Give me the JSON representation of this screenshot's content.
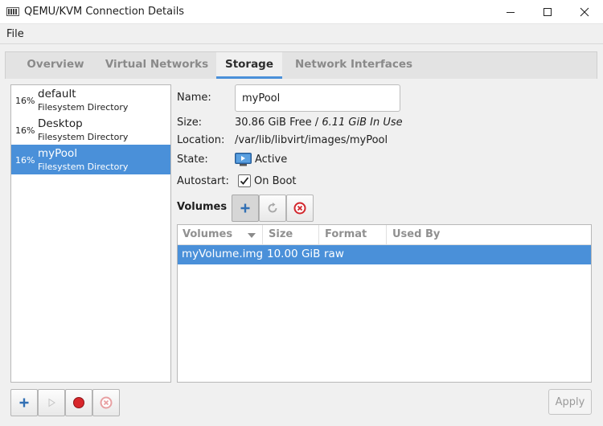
{
  "window": {
    "title": "QEMU/KVM Connection Details",
    "controls": {
      "minimize": "minimize-icon",
      "maximize": "maximize-icon",
      "close": "close-icon"
    }
  },
  "menubar": {
    "file": "File"
  },
  "tabs": [
    {
      "label": "Overview",
      "active": false
    },
    {
      "label": "Virtual Networks",
      "active": false
    },
    {
      "label": "Storage",
      "active": true
    },
    {
      "label": "Network Interfaces",
      "active": false
    }
  ],
  "pools": [
    {
      "percent": "16%",
      "name": "default",
      "type": "Filesystem Directory",
      "selected": false
    },
    {
      "percent": "16%",
      "name": "Desktop",
      "type": "Filesystem Directory",
      "selected": false
    },
    {
      "percent": "16%",
      "name": "myPool",
      "type": "Filesystem Directory",
      "selected": true
    }
  ],
  "details": {
    "name_label": "Name:",
    "name_value": "myPool",
    "size_label": "Size:",
    "size_free": "30.86 GiB Free / ",
    "size_inuse": "6.11 GiB In Use",
    "location_label": "Location:",
    "location_value": "/var/lib/libvirt/images/myPool",
    "state_label": "State:",
    "state_value": "Active",
    "autostart_label": "Autostart:",
    "autostart_value": "On Boot",
    "autostart_checked": true
  },
  "volumes": {
    "title": "Volumes",
    "columns": [
      "Volumes",
      "Size",
      "Format",
      "Used By"
    ],
    "rows": [
      {
        "name": "myVolume.img",
        "size": "10.00 GiB",
        "format": "raw",
        "used_by": "",
        "selected": true
      }
    ]
  },
  "footer": {
    "apply": "Apply"
  },
  "colors": {
    "selection": "#4a90d9",
    "window_bg": "#f0f0f0"
  }
}
